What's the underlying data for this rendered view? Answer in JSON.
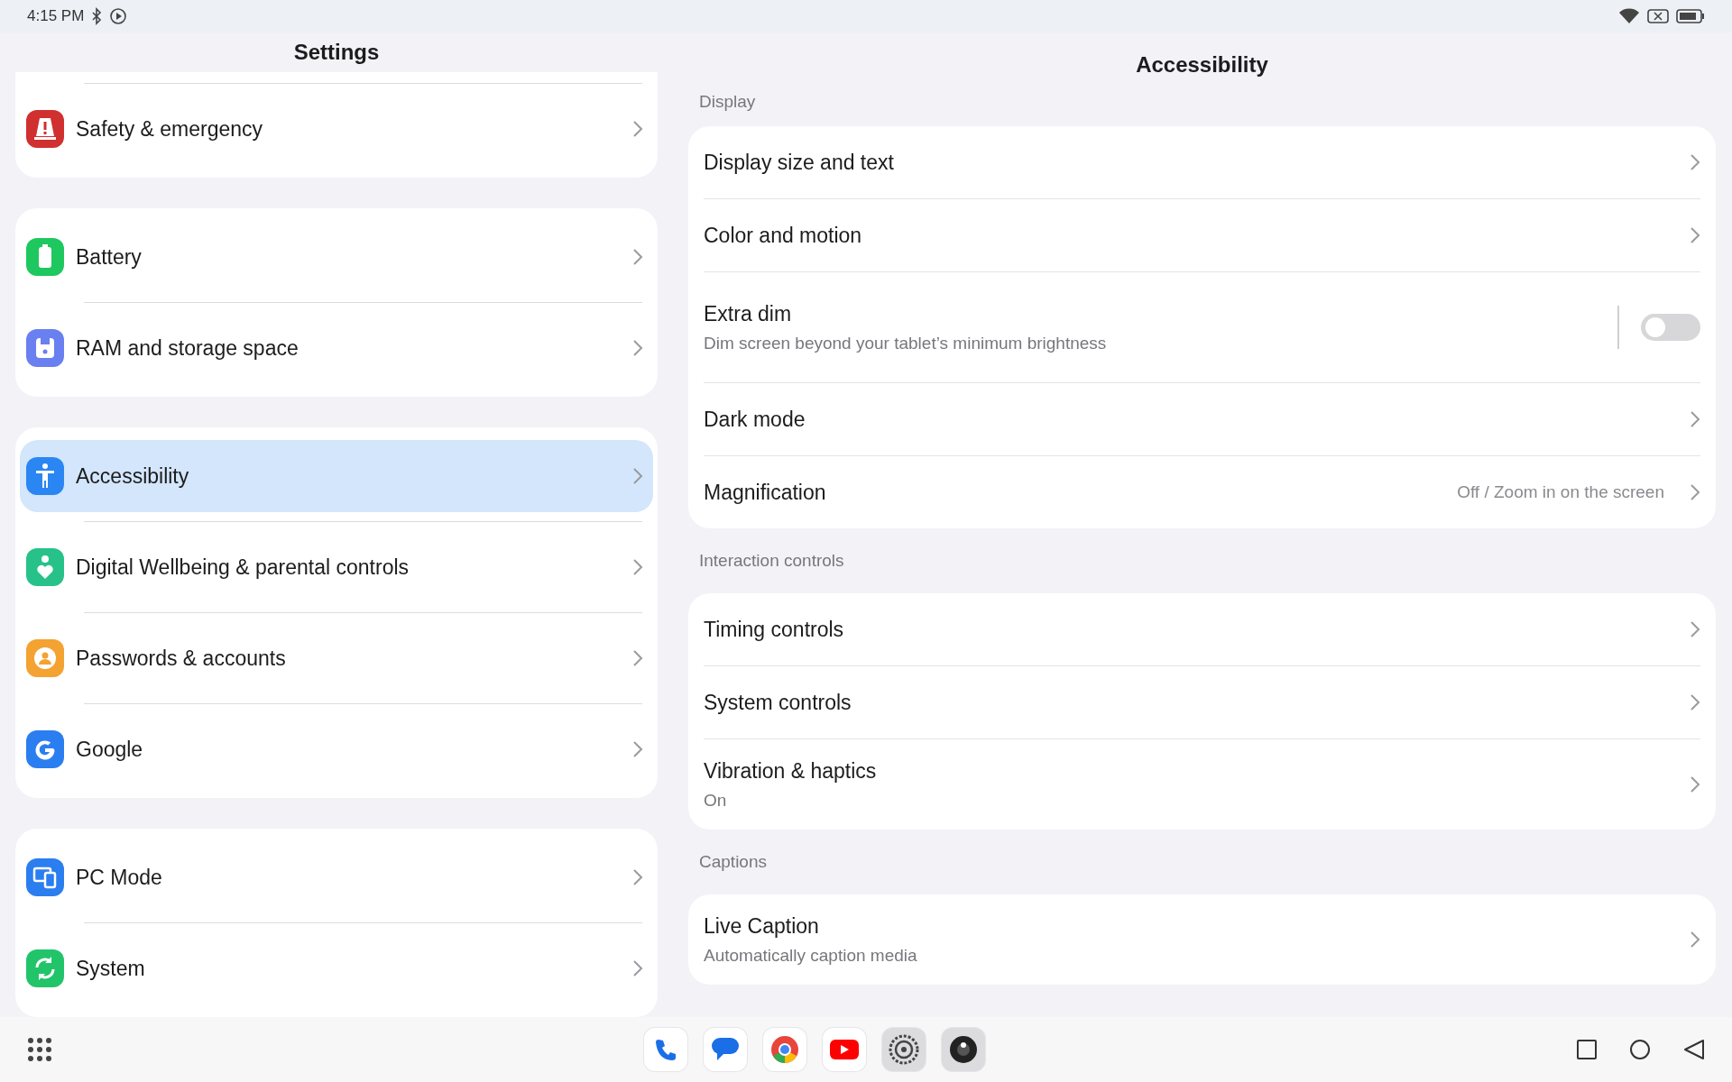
{
  "status_bar": {
    "time": "4:15 PM"
  },
  "settings": {
    "title": "Settings",
    "groups": [
      {
        "items": [
          {
            "label": "Safety & emergency",
            "color": "#d0302f",
            "selected": false
          }
        ]
      },
      {
        "items": [
          {
            "label": "Battery",
            "color": "#1ec85f",
            "selected": false
          },
          {
            "label": "RAM and storage space",
            "color": "#6a7ff0",
            "selected": false
          }
        ]
      },
      {
        "items": [
          {
            "label": "Accessibility",
            "color": "#2a86f3",
            "selected": true
          },
          {
            "label": "Digital Wellbeing & parental controls",
            "color": "#27c289",
            "selected": false
          },
          {
            "label": "Passwords & accounts",
            "color": "#f4a232",
            "selected": false
          },
          {
            "label": "Google",
            "color": "#2a7ef0",
            "selected": false
          }
        ]
      },
      {
        "items": [
          {
            "label": "PC Mode",
            "color": "#2a7ef0",
            "selected": false
          },
          {
            "label": "System",
            "color": "#22c46a",
            "selected": false
          }
        ]
      }
    ]
  },
  "accessibility": {
    "title": "Accessibility",
    "sections": [
      {
        "header": "Display",
        "items": [
          {
            "kind": "link",
            "title": "Display size and text"
          },
          {
            "kind": "link",
            "title": "Color and motion"
          },
          {
            "kind": "toggle",
            "title": "Extra dim",
            "subtitle": "Dim screen beyond your tablet’s minimum brightness",
            "on": false
          },
          {
            "kind": "link",
            "title": "Dark mode"
          },
          {
            "kind": "link",
            "title": "Magnification",
            "value": "Off / Zoom in on the screen"
          }
        ]
      },
      {
        "header": "Interaction controls",
        "items": [
          {
            "kind": "link",
            "title": "Timing controls"
          },
          {
            "kind": "link",
            "title": "System controls"
          },
          {
            "kind": "link",
            "title": "Vibration & haptics",
            "subtitle": "On"
          }
        ]
      },
      {
        "header": "Captions",
        "items": [
          {
            "kind": "link",
            "title": "Live Caption",
            "subtitle": "Automatically caption media"
          }
        ]
      }
    ]
  }
}
